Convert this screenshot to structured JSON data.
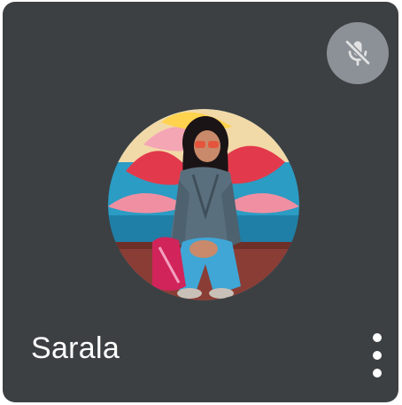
{
  "participant": {
    "name": "Sarala",
    "mic_status_icon": "mic-off-icon",
    "menu_icon": "more-vert-icon",
    "avatar": "profile-photo"
  },
  "colors": {
    "tile_background": "#3c4043",
    "badge_background": "#9aa0a6",
    "name_text": "#ffffff"
  }
}
